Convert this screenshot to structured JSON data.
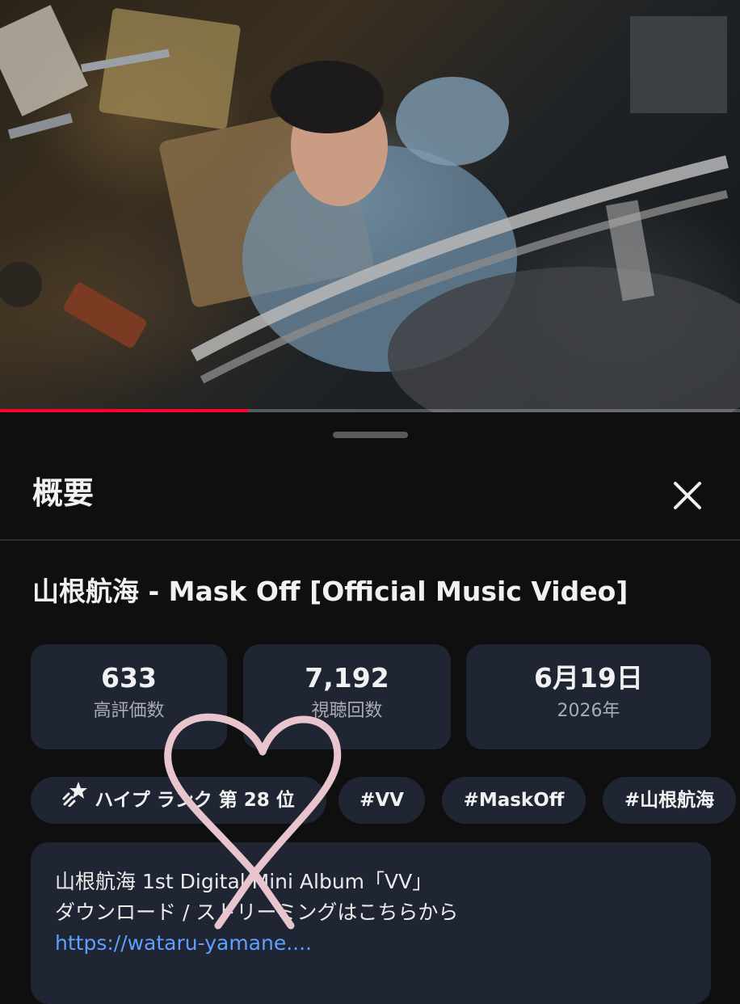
{
  "player": {
    "progress_fraction": 0.335,
    "progress_color": "#ff0033"
  },
  "panel": {
    "heading": "概要",
    "close_icon": "close-icon"
  },
  "video": {
    "title": "山根航海 - Mask Off [Official Music Video]"
  },
  "stats": [
    {
      "value": "633",
      "label": "高評価数"
    },
    {
      "value": "7,192",
      "label": "視聴回数"
    },
    {
      "value": "6月19日",
      "label": "2026年"
    }
  ],
  "chips": [
    {
      "icon": "hype-star-icon",
      "label": "ハイプ ランク 第 28 位"
    },
    {
      "label": "#VV"
    },
    {
      "label": "#MaskOff"
    },
    {
      "label": "#山根航海"
    }
  ],
  "description": {
    "line1": "山根航海 1st Digital Mini Album「VV」",
    "line2": "ダウンロード / ストリーミングはこちらから",
    "link": "https://wataru-yamane...."
  },
  "overlay": {
    "sticker": "hand-drawn-heart-icon",
    "color": "#e8c4cc"
  }
}
